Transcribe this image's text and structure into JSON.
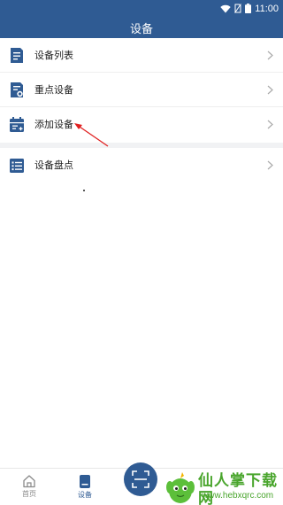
{
  "status_bar": {
    "time": "11:00"
  },
  "header": {
    "title": "设备"
  },
  "menu": {
    "items": [
      {
        "label": "设备列表",
        "icon": "document-list-icon"
      },
      {
        "label": "重点设备",
        "icon": "document-key-icon"
      },
      {
        "label": "添加设备",
        "icon": "calendar-add-icon"
      },
      {
        "label": "设备盘点",
        "icon": "checklist-icon"
      }
    ]
  },
  "bottom_nav": {
    "tabs": [
      {
        "label": "首页",
        "icon": "home-icon",
        "active": false
      },
      {
        "label": "设备",
        "icon": "device-icon",
        "active": true
      }
    ],
    "scan_icon": "scan-icon"
  },
  "watermark": {
    "text": "仙人掌下载网",
    "url": "www.hebxqrc.com"
  },
  "colors": {
    "primary": "#2f5b93",
    "annotation_arrow": "#e02020",
    "watermark_green": "#49a52c"
  }
}
